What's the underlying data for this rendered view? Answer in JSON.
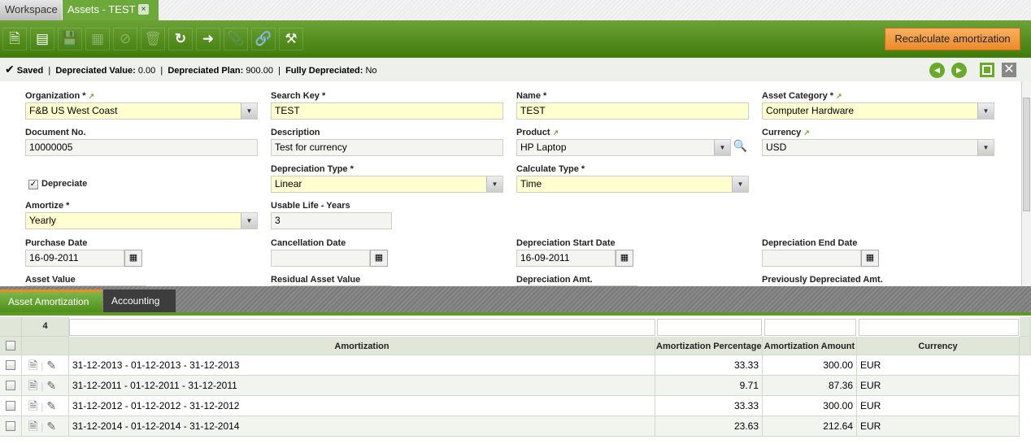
{
  "window_tabs": [
    {
      "label": "Workspace"
    },
    {
      "label": "Assets - TEST",
      "close": "×"
    }
  ],
  "toolbar": {
    "icons": [
      "new-document-icon",
      "new-grid-record-icon",
      "save-icon",
      "save-close-icon",
      "undo-icon",
      "delete-icon",
      "refresh-icon",
      "export-icon",
      "attachment-icon",
      "link-icon",
      "tools-icon"
    ],
    "recalc_label": "Recalculate amortization"
  },
  "status": {
    "saved": "Saved",
    "dep_value_label": "Depreciated Value:",
    "dep_value": "0.00",
    "dep_plan_label": "Depreciated Plan:",
    "dep_plan": "900.00",
    "fully_label": "Fully Depreciated:",
    "fully": "No"
  },
  "form": {
    "organization": {
      "label": "Organization *",
      "value": "F&B US West Coast"
    },
    "search_key": {
      "label": "Search Key *",
      "value": "TEST"
    },
    "name": {
      "label": "Name *",
      "value": "TEST"
    },
    "asset_category": {
      "label": "Asset Category *",
      "value": "Computer Hardware"
    },
    "document_no": {
      "label": "Document No.",
      "value": "10000005"
    },
    "description": {
      "label": "Description",
      "value": "Test for currency"
    },
    "product": {
      "label": "Product",
      "value": "HP Laptop"
    },
    "currency": {
      "label": "Currency",
      "value": "USD"
    },
    "depreciate": {
      "label": "Depreciate",
      "checked": true
    },
    "depreciation_type": {
      "label": "Depreciation Type *",
      "value": "Linear"
    },
    "calculate_type": {
      "label": "Calculate Type *",
      "value": "Time"
    },
    "amortize": {
      "label": "Amortize *",
      "value": "Yearly"
    },
    "usable_life": {
      "label": "Usable Life - Years",
      "value": "3"
    },
    "purchase_date": {
      "label": "Purchase Date",
      "value": "16-09-2011"
    },
    "cancellation_date": {
      "label": "Cancellation Date",
      "value": ""
    },
    "dep_start_date": {
      "label": "Depreciation Start Date",
      "value": "16-09-2011"
    },
    "dep_end_date": {
      "label": "Depreciation End Date",
      "value": ""
    },
    "asset_value": {
      "label": "Asset Value"
    },
    "residual_value": {
      "label": "Residual Asset Value"
    },
    "dep_amt": {
      "label": "Depreciation Amt."
    },
    "prev_dep_amt": {
      "label": "Previously Depreciated Amt."
    }
  },
  "bottom_tabs": [
    {
      "label": "Asset Amortization"
    },
    {
      "label": "Accounting"
    }
  ],
  "grid": {
    "count": "4",
    "columns": [
      "Amortization",
      "Amortization Percentage",
      "Amortization Amount",
      "Currency"
    ],
    "rows": [
      {
        "amortization": "31-12-2013 - 01-12-2013 - 31-12-2013",
        "pct": "33.33",
        "amount": "300.00",
        "currency": "EUR"
      },
      {
        "amortization": "31-12-2011 - 01-12-2011 - 31-12-2011",
        "pct": "9.71",
        "amount": "87.36",
        "currency": "EUR"
      },
      {
        "amortization": "31-12-2012 - 01-12-2012 - 31-12-2012",
        "pct": "33.33",
        "amount": "300.00",
        "currency": "EUR"
      },
      {
        "amortization": "31-12-2014 - 01-12-2014 - 31-12-2014",
        "pct": "23.63",
        "amount": "212.64",
        "currency": "EUR"
      }
    ]
  }
}
